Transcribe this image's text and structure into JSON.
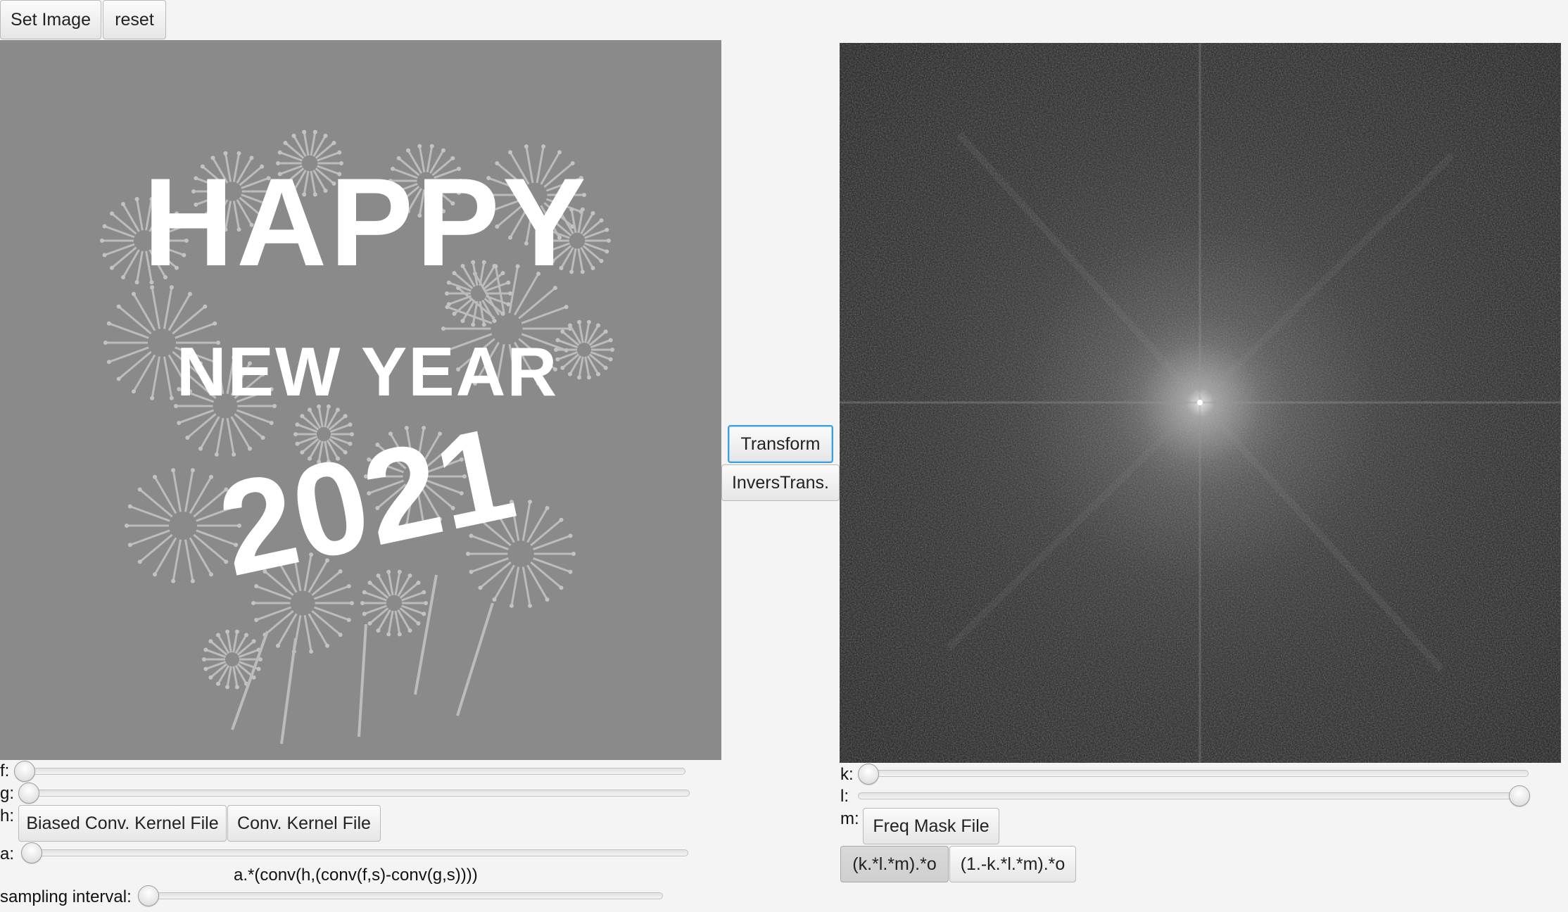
{
  "toolbar": {
    "set_image_label": "Set Image",
    "reset_label": "reset"
  },
  "left_image": {
    "line1": "HAPPY",
    "line2": "NEW YEAR",
    "line3": "2021"
  },
  "center": {
    "transform_label": "Transform",
    "inverse_label": "InversTrans."
  },
  "left_controls": {
    "f_label": "f:",
    "g_label": "g:",
    "h_label": "h:",
    "biased_kernel_label": "Biased Conv. Kernel File",
    "kernel_label": "Conv. Kernel File",
    "a_label": "a:",
    "formula": "a.*(conv(h,(conv(f,s)-conv(g,s))))",
    "sampling_label": "sampling interval:",
    "f_value": 0,
    "g_value": 0,
    "a_value": 0,
    "sampling_value": 0
  },
  "right_controls": {
    "k_label": "k:",
    "l_label": "l:",
    "m_label": "m:",
    "freq_mask_label": "Freq Mask File",
    "op1_label": "(k.*l.*m).*o",
    "op2_label": "(1.-k.*l.*m).*o",
    "k_value": 0,
    "l_value": 1
  },
  "colors": {
    "focus": "#3c9fdc",
    "left_bg": "#8a8a8a",
    "spectrum_bg": "#1e1e1e"
  }
}
